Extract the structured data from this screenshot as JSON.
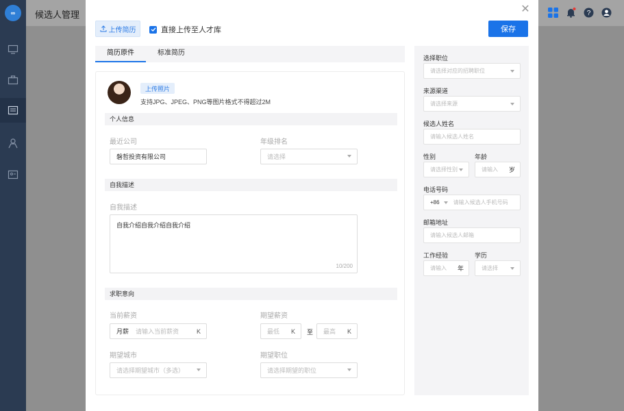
{
  "app": {
    "title": "候选人管理",
    "logo_text": "∞"
  },
  "modal": {
    "upload_resume_label": "上传简历",
    "direct_upload_label": "直接上传至人才库",
    "save_label": "保存",
    "tabs": [
      {
        "label": "简历原件"
      },
      {
        "label": "标准简历"
      }
    ],
    "photo": {
      "button_label": "上传照片",
      "hint": "支持JPG、JPEG、PNG等图片格式不得超过2M"
    },
    "personal": {
      "section_title": "个人信息",
      "recent_company_label": "最近公司",
      "recent_company_value": "磐哲投资有限公司",
      "grade_rank_label": "年级排名",
      "grade_rank_placeholder": "请选择"
    },
    "self_desc": {
      "section_title": "自我描述",
      "label": "自我描述",
      "value": "自我介绍自我介绍自我介绍",
      "counter": "10/200"
    },
    "intention": {
      "section_title": "求职意向",
      "current_salary_label": "当前薪资",
      "current_salary_prefix": "月薪",
      "current_salary_placeholder": "请输入当前薪资",
      "current_salary_unit": "K",
      "expected_salary_label": "期望薪资",
      "min_placeholder": "最低",
      "max_placeholder": "最高",
      "unit": "K",
      "range_sep": "至",
      "expected_city_label": "期望城市",
      "expected_city_placeholder": "请选择期望城市（多选）",
      "expected_position_label": "期望职位",
      "expected_position_placeholder": "请选择期望的职位"
    },
    "right": {
      "position_label": "选择职位",
      "position_placeholder": "请选择对应的招聘职位",
      "source_label": "来源渠道",
      "source_placeholder": "请选择来源",
      "name_label": "候选人姓名",
      "name_placeholder": "请输入候选人姓名",
      "gender_label": "性别",
      "gender_placeholder": "请选择性别",
      "age_label": "年龄",
      "age_placeholder": "请输入",
      "age_unit": "岁",
      "phone_label": "电话号码",
      "phone_code": "+86",
      "phone_placeholder": "请输入候选人手机号码",
      "email_label": "邮箱地址",
      "email_placeholder": "请输入候选人邮箱",
      "experience_label": "工作经验",
      "experience_placeholder": "请输入",
      "experience_unit": "年",
      "education_label": "学历",
      "education_placeholder": "请选择"
    }
  },
  "colors": {
    "primary": "#1a73e8",
    "sidebar": "#2b3b52"
  }
}
